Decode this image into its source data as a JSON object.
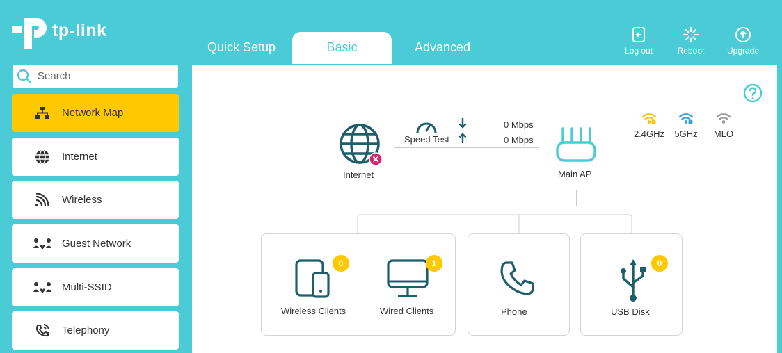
{
  "brand": {
    "name": "tp-link"
  },
  "tabs": [
    {
      "label": "Quick Setup"
    },
    {
      "label": "Basic"
    },
    {
      "label": "Advanced"
    }
  ],
  "header_buttons": {
    "logout": "Log out",
    "reboot": "Reboot",
    "upgrade": "Upgrade"
  },
  "search": {
    "placeholder": "Search"
  },
  "sidebar": {
    "items": [
      {
        "label": "Network Map",
        "icon": "network-map-icon"
      },
      {
        "label": "Internet",
        "icon": "globe-icon"
      },
      {
        "label": "Wireless",
        "icon": "wireless-icon"
      },
      {
        "label": "Guest Network",
        "icon": "guest-network-icon"
      },
      {
        "label": "Multi-SSID",
        "icon": "multi-ssid-icon"
      },
      {
        "label": "Telephony",
        "icon": "telephony-icon"
      }
    ]
  },
  "map": {
    "internet_label": "Internet",
    "speed_test_label": "Speed Test",
    "download": "0 Mbps",
    "upload": "0 Mbps",
    "main_ap_label": "Main AP",
    "bands": [
      "2.4GHz",
      "5GHz",
      "MLO"
    ],
    "wireless_clients": {
      "label": "Wireless Clients",
      "count": "0"
    },
    "wired_clients": {
      "label": "Wired Clients",
      "count": "1"
    },
    "phone": {
      "label": "Phone"
    },
    "usb_disk": {
      "label": "USB Disk",
      "count": "0"
    }
  },
  "colors": {
    "brand_teal": "#4acbd6",
    "active_yellow": "#ffc800",
    "icon_dark_teal": "#1c5f6b",
    "error_pink": "#d6246e",
    "band_24": "#f5c518",
    "band_5": "#3aa3d9",
    "band_mlo": "#9e9e9e"
  }
}
